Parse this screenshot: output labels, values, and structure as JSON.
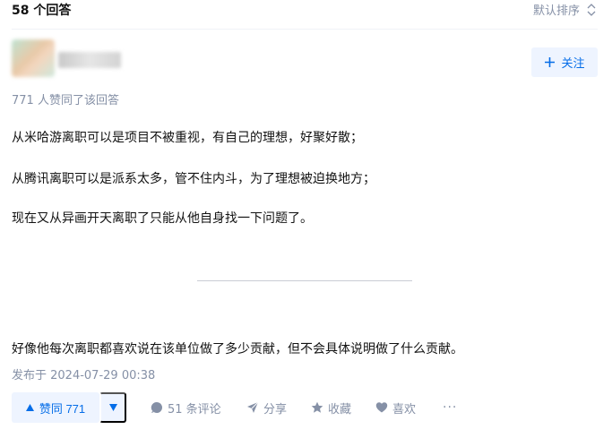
{
  "header": {
    "answer_count": "58 个回答",
    "sort_label": "默认排序"
  },
  "author": {
    "follow_label": "关注"
  },
  "answer": {
    "upvote_note": "771 人赞同了该回答",
    "paragraphs": [
      "从米哈游离职可以是项目不被重视，有自己的理想，好聚好散；",
      "从腾讯离职可以是派系太多，管不住内斗，为了理想被迫换地方；",
      "现在又从异画开天离职了只能从他自身找一下问题了。",
      "好像他每次离职都喜欢说在该单位做了多少贡献，但不会具体说明做了什么贡献。"
    ],
    "published": "发布于 2024-07-29 00:38"
  },
  "actions": {
    "upvote_label": "赞同 771",
    "comments_label": "51 条评论",
    "share_label": "分享",
    "collect_label": "收藏",
    "like_label": "喜欢",
    "more_label": "···"
  },
  "colors": {
    "accent": "#056de8",
    "accent_bg": "#eef4ff",
    "muted": "#8590a6"
  },
  "icons": [
    "sort-icon",
    "plus-icon",
    "upvote-triangle-icon",
    "downvote-triangle-icon",
    "comment-icon",
    "share-icon",
    "star-icon",
    "heart-icon",
    "more-icon"
  ]
}
